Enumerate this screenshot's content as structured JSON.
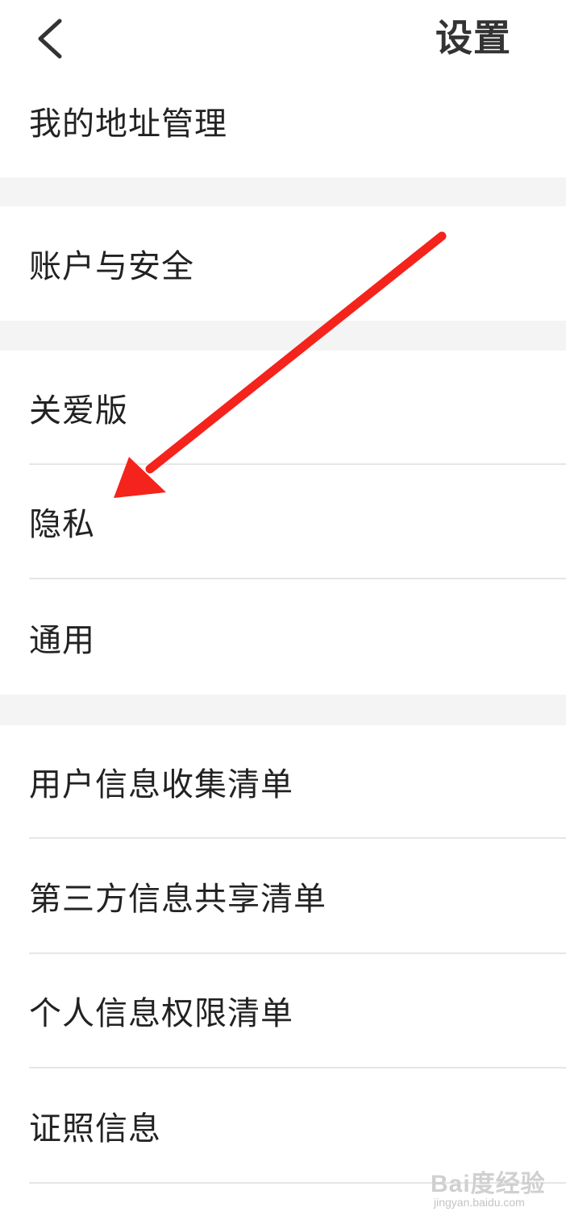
{
  "header": {
    "title": "设置",
    "back_icon": "chevron-left-icon"
  },
  "items": {
    "address": "我的地址管理",
    "account_security": "账户与安全",
    "care_mode": "关爱版",
    "privacy": "隐私",
    "general": "通用",
    "user_info_list": "用户信息收集清单",
    "third_party_list": "第三方信息共享清单",
    "permission_list": "个人信息权限清单",
    "license_info": "证照信息"
  },
  "annotation": {
    "arrow_color": "#f4231c",
    "points_to": "privacy"
  },
  "watermark": {
    "brand": "Bai度经验",
    "url": "jingyan.baidu.com"
  },
  "colors": {
    "background": "#ffffff",
    "section_gap": "#f4f4f4",
    "divider": "#e6e6e6",
    "text": "#222222"
  }
}
